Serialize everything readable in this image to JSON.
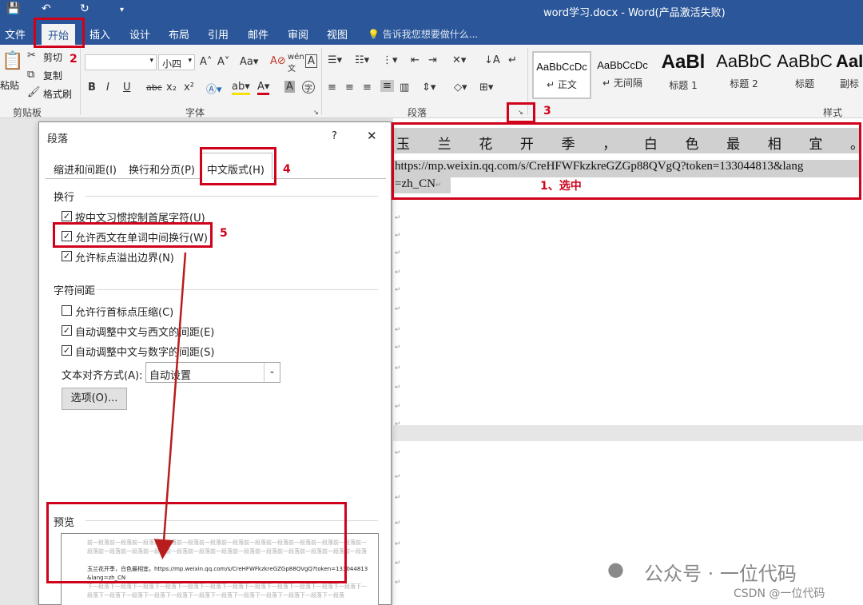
{
  "window": {
    "title": "word学习.docx - Word(产品激活失败)"
  },
  "qat": [
    "💾",
    "↶",
    "↻",
    "▾"
  ],
  "tabs": [
    "文件",
    "开始",
    "插入",
    "设计",
    "布局",
    "引用",
    "邮件",
    "审阅",
    "视图"
  ],
  "tell_me": "告诉我您想要做什么...",
  "clipboard": {
    "paste": "粘贴",
    "cut": "剪切",
    "copy": "复制",
    "format_painter": "格式刷",
    "group": "剪贴板"
  },
  "font": {
    "name_value": "",
    "size_value": "小四",
    "group": "字体"
  },
  "paragraph": {
    "group": "段落"
  },
  "styles": {
    "group": "样式",
    "items": [
      {
        "sample": "AaBbCcDc",
        "name": "正文"
      },
      {
        "sample": "AaBbCcDc",
        "name": "无间隔"
      },
      {
        "sample": "AaBl",
        "name": "标题 1"
      },
      {
        "sample": "AaBbC",
        "name": "标题 2"
      },
      {
        "sample": "AaBbC",
        "name": "标题"
      },
      {
        "sample": "AaI",
        "name": "副标"
      }
    ]
  },
  "document": {
    "line1": [
      "玉",
      "兰",
      "花",
      "开",
      "季",
      "，",
      "白",
      "色",
      "最",
      "相",
      "宜",
      "。"
    ],
    "url_line1": "https://mp.weixin.qq.com/s/CreHFWFkzkreGZGp88QVgQ?token=133044813&lang",
    "url_line2": "=zh_CN",
    "para_marks": "↵"
  },
  "dialog": {
    "title": "段落",
    "help": "?",
    "close": "✕",
    "tabs": [
      "缩进和间距(I)",
      "换行和分页(P)",
      "中文版式(H)"
    ],
    "wrap_section": "换行",
    "wrap_options": [
      {
        "label": "按中文习惯控制首尾字符(U)",
        "checked": true
      },
      {
        "label": "允许西文在单词中间换行(W)",
        "checked": true
      },
      {
        "label": "允许标点溢出边界(N)",
        "checked": true
      }
    ],
    "spacing_section": "字符间距",
    "spacing_options": [
      {
        "label": "允许行首标点压缩(C)",
        "checked": false
      },
      {
        "label": "自动调整中文与西文的间距(E)",
        "checked": true
      },
      {
        "label": "自动调整中文与数字的间距(S)",
        "checked": true
      }
    ],
    "align_label": "文本对齐方式(A):",
    "align_value": "自动设置",
    "options_button": "选项(O)...",
    "preview_label": "预览",
    "preview_before": "前一段落前一段落前一段落前一段落前一段落前一段落前一段落前一段落前一段落前一段落前一段落前一段落前一段落前一段落前一段落前一段落前一段落前一段落前一段落前一段落前一段落前一段落前一段落前一段落前一段落",
    "preview_sample": "玉兰花开季，白色最相宜。https://mp.weixin.qq.com/s/CreHFWFkzkreGZGp88QVgQ?token=133044813&lang=zh_CN",
    "preview_after": "下一段落下一段落下一段落下一段落下一段落下一段落下一段落下一段落下一段落下一段落下一段落下一段落下一段落下一段落下一段落下一段落下一段落下一段落下一段落下一段落下一段落下一段落下一段落下一段落"
  },
  "annotations": {
    "n1": "1、选中",
    "n2": "2",
    "n3": "3",
    "n4": "4",
    "n5": "5"
  },
  "watermark": {
    "account": "公众号 · 一位代码",
    "csdn": "CSDN @一位代码"
  }
}
